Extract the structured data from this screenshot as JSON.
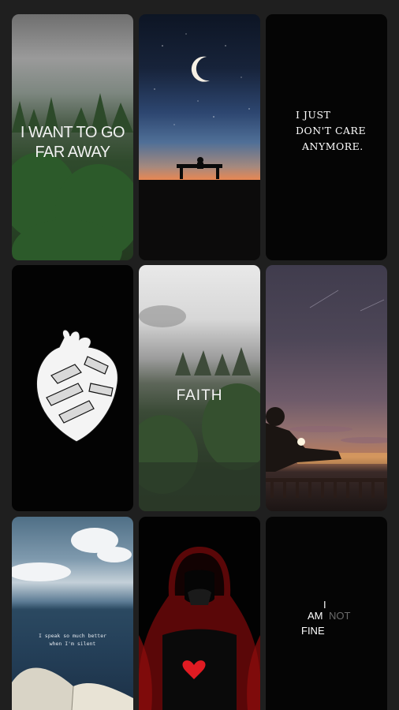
{
  "wallpapers": [
    {
      "id": "forest-quote",
      "text": "I WANT TO GO FAR AWAY"
    },
    {
      "id": "night-sky-bench"
    },
    {
      "id": "dont-care",
      "lines": [
        "I JUST",
        "DON'T CARE",
        "ANYMORE."
      ]
    },
    {
      "id": "heart-sketch"
    },
    {
      "id": "faith-forest",
      "text": "FAITH"
    },
    {
      "id": "sunset-boy"
    },
    {
      "id": "ocean-book",
      "lines": [
        "I speak so much better",
        "when I'm silent"
      ]
    },
    {
      "id": "hooded-figure"
    },
    {
      "id": "i-am-not-fine",
      "line1": "I",
      "line2_a": "AM",
      "line2_b": "NOT",
      "line3": "FINE"
    }
  ],
  "colors": {
    "background": "#1f1f1f",
    "heart_red": "#e01b22",
    "sunset_orange": "#f07c3d"
  }
}
